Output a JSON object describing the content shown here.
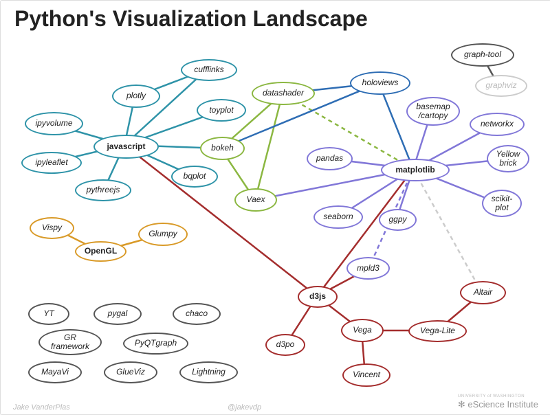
{
  "title": "Python's Visualization\nLandscape",
  "attrib": {
    "author": "Jake VanderPlas",
    "handle": "@jakevdp",
    "institute": "eScience Institute",
    "university": "UNIVERSITY of WASHINGTON"
  },
  "hubs": {
    "javascript": "javascript",
    "matplotlib": "matplotlib",
    "opengl": "OpenGL",
    "d3js": "d3js"
  },
  "nodes": {
    "ipyvolume": "ipyvolume",
    "plotly": "plotly",
    "cufflinks": "cufflinks",
    "toyplot": "toyplot",
    "ipyleaflet": "ipyleaflet",
    "pythreejs": "pythreejs",
    "bokeh": "bokeh",
    "bqplot": "bqplot",
    "datashader": "datashader",
    "vaex": "Vaex",
    "holoviews": "holoviews",
    "pandas": "pandas",
    "seaborn": "seaborn",
    "ggpy": "ggpy",
    "basemap": "basemap\n/cartopy",
    "networkx": "networkx",
    "yellowbrick": "Yellow\nbrick",
    "scikitplot": "scikit-\nplot",
    "mpld3": "mpld3",
    "graphtool": "graph-tool",
    "graphviz": "graphviz",
    "vispy": "Vispy",
    "glumpy": "Glumpy",
    "yt": "YT",
    "pygal": "pygal",
    "chaco": "chaco",
    "gr": "GR\nframework",
    "pyqtgraph": "PyQTgraph",
    "mayavi": "MayaVi",
    "glueviz": "GlueViz",
    "lightning": "Lightning",
    "d3po": "d3po",
    "vega": "Vega",
    "vincent": "Vincent",
    "vegalite": "Vega-Lite",
    "altair": "Altair"
  }
}
